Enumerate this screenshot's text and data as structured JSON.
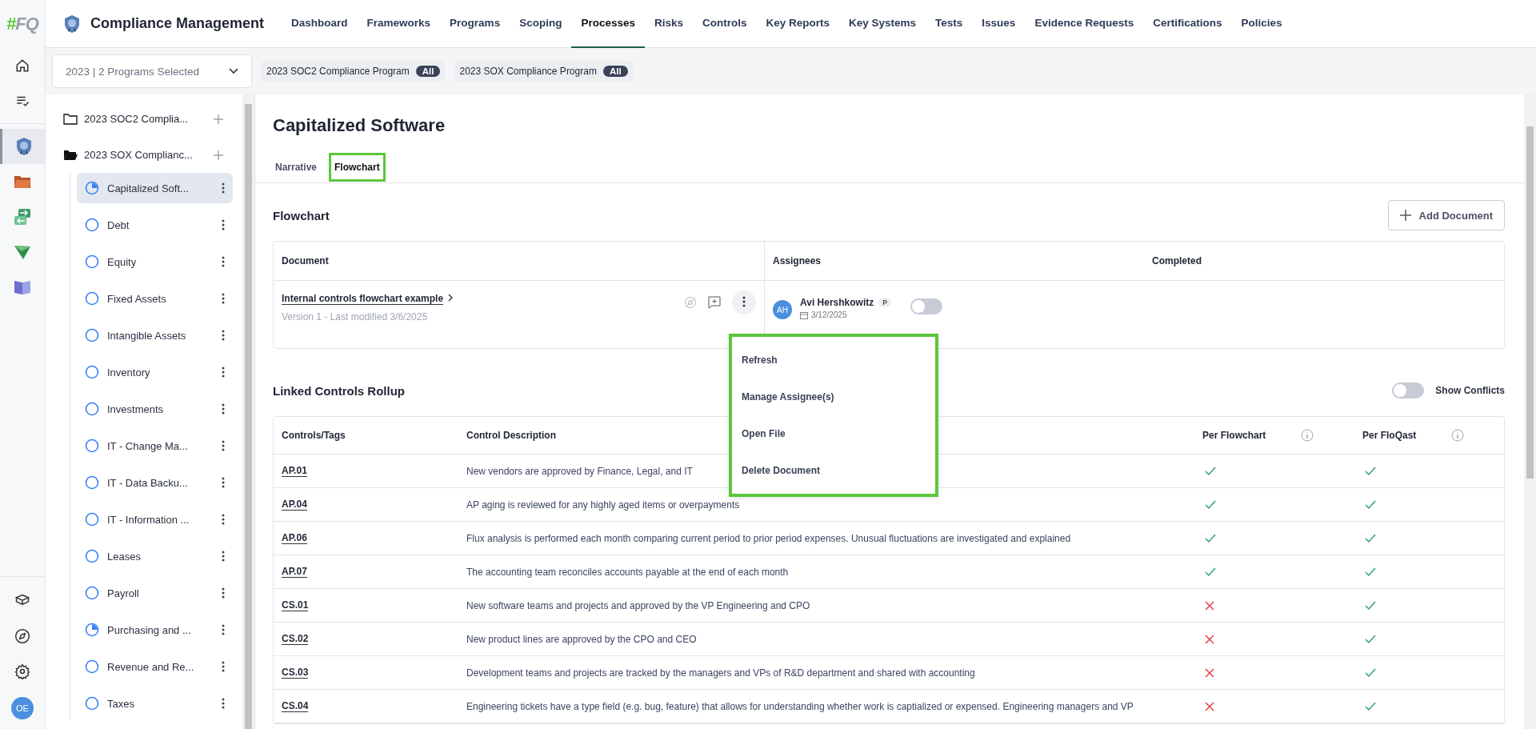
{
  "logo": {
    "mark": "#",
    "text": "FQ"
  },
  "rail": {
    "items": [
      {
        "kind": "home",
        "selected": false
      },
      {
        "kind": "tasks",
        "selected": false
      },
      {
        "kind": "compliance",
        "selected": true
      },
      {
        "kind": "folder",
        "selected": false
      },
      {
        "kind": "sync",
        "selected": false
      },
      {
        "kind": "send",
        "selected": false
      },
      {
        "kind": "book",
        "selected": false
      }
    ],
    "bottom": [
      {
        "kind": "learn"
      },
      {
        "kind": "explore"
      },
      {
        "kind": "settings"
      }
    ],
    "avatar": "OE"
  },
  "header": {
    "title": "Compliance Management",
    "nav": [
      {
        "label": "Dashboard",
        "selected": false
      },
      {
        "label": "Frameworks",
        "selected": false
      },
      {
        "label": "Programs",
        "selected": false
      },
      {
        "label": "Scoping",
        "selected": false
      },
      {
        "label": "Processes",
        "selected": true
      },
      {
        "label": "Risks",
        "selected": false
      },
      {
        "label": "Controls",
        "selected": false
      },
      {
        "label": "Key Reports",
        "selected": false
      },
      {
        "label": "Key Systems",
        "selected": false
      },
      {
        "label": "Tests",
        "selected": false
      },
      {
        "label": "Issues",
        "selected": false
      },
      {
        "label": "Evidence Requests",
        "selected": false
      },
      {
        "label": "Certifications",
        "selected": false
      },
      {
        "label": "Policies",
        "selected": false
      }
    ]
  },
  "filter": {
    "select": "2023 | 2 Programs Selected",
    "chips": [
      {
        "label": "2023 SOC2 Compliance Program",
        "badge": "All"
      },
      {
        "label": "2023 SOX Compliance Program",
        "badge": "All"
      }
    ]
  },
  "tree": [
    {
      "label": "2023 SOC2 Complia...",
      "expanded": false
    },
    {
      "label": "2023 SOX Complianc...",
      "expanded": true,
      "children": [
        {
          "label": "Capitalized Soft...",
          "in_progress": true,
          "selected": true
        },
        {
          "label": "Debt",
          "in_progress": false,
          "selected": false
        },
        {
          "label": "Equity",
          "in_progress": false,
          "selected": false
        },
        {
          "label": "Fixed Assets",
          "in_progress": false,
          "selected": false
        },
        {
          "label": "Intangible Assets",
          "in_progress": false,
          "selected": false
        },
        {
          "label": "Inventory",
          "in_progress": false,
          "selected": false
        },
        {
          "label": "Investments",
          "in_progress": false,
          "selected": false
        },
        {
          "label": "IT - Change Ma...",
          "in_progress": false,
          "selected": false
        },
        {
          "label": "IT - Data Backu...",
          "in_progress": false,
          "selected": false
        },
        {
          "label": "IT - Information ...",
          "in_progress": false,
          "selected": false
        },
        {
          "label": "Leases",
          "in_progress": false,
          "selected": false
        },
        {
          "label": "Payroll",
          "in_progress": false,
          "selected": false
        },
        {
          "label": "Purchasing and ...",
          "in_progress": true,
          "selected": false
        },
        {
          "label": "Revenue and Re...",
          "in_progress": false,
          "selected": false
        },
        {
          "label": "Taxes",
          "in_progress": false,
          "selected": false
        }
      ]
    }
  ],
  "page": {
    "title": "Capitalized Software",
    "tabs": [
      {
        "label": "Narrative",
        "selected": false
      },
      {
        "label": "Flowchart",
        "selected": true
      }
    ]
  },
  "flowchart": {
    "heading": "Flowchart",
    "add_button": "Add Document",
    "columns": [
      "Document",
      "Assignees",
      "Completed"
    ],
    "rows": [
      {
        "document": "Internal controls flowchart example",
        "version": "Version 1 - Last modified 3/6/2025",
        "assignee": {
          "initials": "AH",
          "name": "Avi Hershkowitz",
          "badge": "P",
          "date": "3/12/2025"
        },
        "completed": false
      }
    ],
    "menu": [
      "Refresh",
      "Manage Assignee(s)",
      "Open File",
      "Delete Document"
    ]
  },
  "rollup": {
    "heading": "Linked Controls Rollup",
    "show_conflicts": {
      "label": "Show Conflicts",
      "on": false
    },
    "columns": [
      "Controls/Tags",
      "Control Description",
      "Per Flowchart",
      "Per FloQast"
    ],
    "rows": [
      {
        "code": "AP.01",
        "description": "New vendors are approved by Finance, Legal, and IT",
        "per_flowchart": true,
        "per_floqast": true
      },
      {
        "code": "AP.04",
        "description": "AP aging is reviewed for any highly aged items or overpayments",
        "per_flowchart": true,
        "per_floqast": true
      },
      {
        "code": "AP.06",
        "description": "Flux analysis is performed each month comparing current period to prior period expenses. Unusual fluctuations are investigated and explained",
        "per_flowchart": true,
        "per_floqast": true
      },
      {
        "code": "AP.07",
        "description": "The accounting team reconciles accounts payable at the end of each month",
        "per_flowchart": true,
        "per_floqast": true
      },
      {
        "code": "CS.01",
        "description": "New software teams and projects and approved by the VP Engineering and CPO",
        "per_flowchart": false,
        "per_floqast": true
      },
      {
        "code": "CS.02",
        "description": "New product lines are approved by the CPO and CEO",
        "per_flowchart": false,
        "per_floqast": true
      },
      {
        "code": "CS.03",
        "description": "Development teams and projects are tracked by the managers and VPs of R&D department and shared with accounting",
        "per_flowchart": false,
        "per_floqast": true
      },
      {
        "code": "CS.04",
        "description": "Engineering tickets have a type field (e.g. bug, feature) that allows for understanding whether work is captialized or expensed. Engineering managers and VP",
        "per_flowchart": false,
        "per_floqast": true
      }
    ]
  }
}
